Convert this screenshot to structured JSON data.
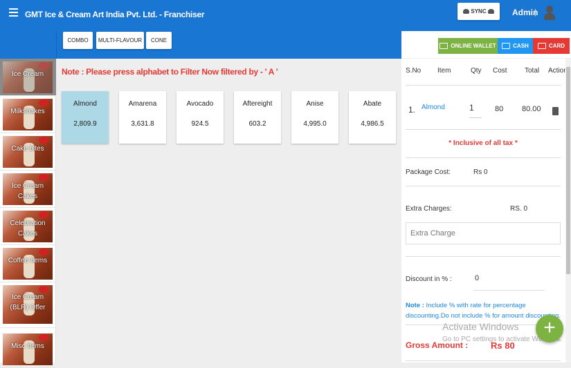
{
  "header": {
    "title": "GMT Ice & Cream Art India Pvt. Ltd. - Franchiser",
    "sync": "SYNC",
    "user": "Admin",
    "sep": "|"
  },
  "category_tabs": [
    "COMBO",
    "MULTI-FLAVOUR",
    "CONE"
  ],
  "sidebar": [
    "Ice Cream",
    "Milkshakes",
    "Cake bites",
    "Ice Cream Cakes",
    "Celebration Cakes",
    "Coffee Items",
    "Ice Cream (BLR) Offer",
    "Misc Items"
  ],
  "note": "Note : Please press alphabet to Filter Now filtered by - ' A '",
  "products": [
    {
      "name": "Almond",
      "price": "2,809.9"
    },
    {
      "name": "Amarena",
      "price": "3,631.8"
    },
    {
      "name": "Avocado",
      "price": "924.5"
    },
    {
      "name": "Aftereight",
      "price": "603.2"
    },
    {
      "name": "Anise",
      "price": "4,995.0"
    },
    {
      "name": "Abate",
      "price": "4,986.5"
    }
  ],
  "payment": {
    "wallet": "ONLINE WALLET",
    "cash": "CASH",
    "card": "CARD",
    "colors": {
      "wallet": "#7cb342",
      "cash": "#2196f3",
      "card": "#e53935"
    }
  },
  "cart": {
    "columns": [
      "S.No",
      "Item",
      "Qty",
      "Cost",
      "Total",
      "Action"
    ],
    "rows": [
      {
        "sno": "1.",
        "item": "Almond",
        "qty": "1",
        "cost": "80",
        "total": "80.00"
      }
    ],
    "tax_note": "* Inclusive of all tax *",
    "package_label": "Package Cost:",
    "package_value": "Rs 0",
    "extra_label": "Extra Charges:",
    "extra_value": "RS. 0",
    "extra_placeholder": "Extra Charge",
    "discount_label": "Discount in % :",
    "discount_value": "0",
    "discount_note_bold": "Note :",
    "discount_note": " Include % with rate for percentage discounting.Do not include % for amount discounting.",
    "gross_label": "Gross Amount :",
    "gross_value": "Rs 80"
  },
  "watermark": {
    "line1": "Activate Windows",
    "line2": "Go to PC settings to activate Windows."
  },
  "fab": "+"
}
